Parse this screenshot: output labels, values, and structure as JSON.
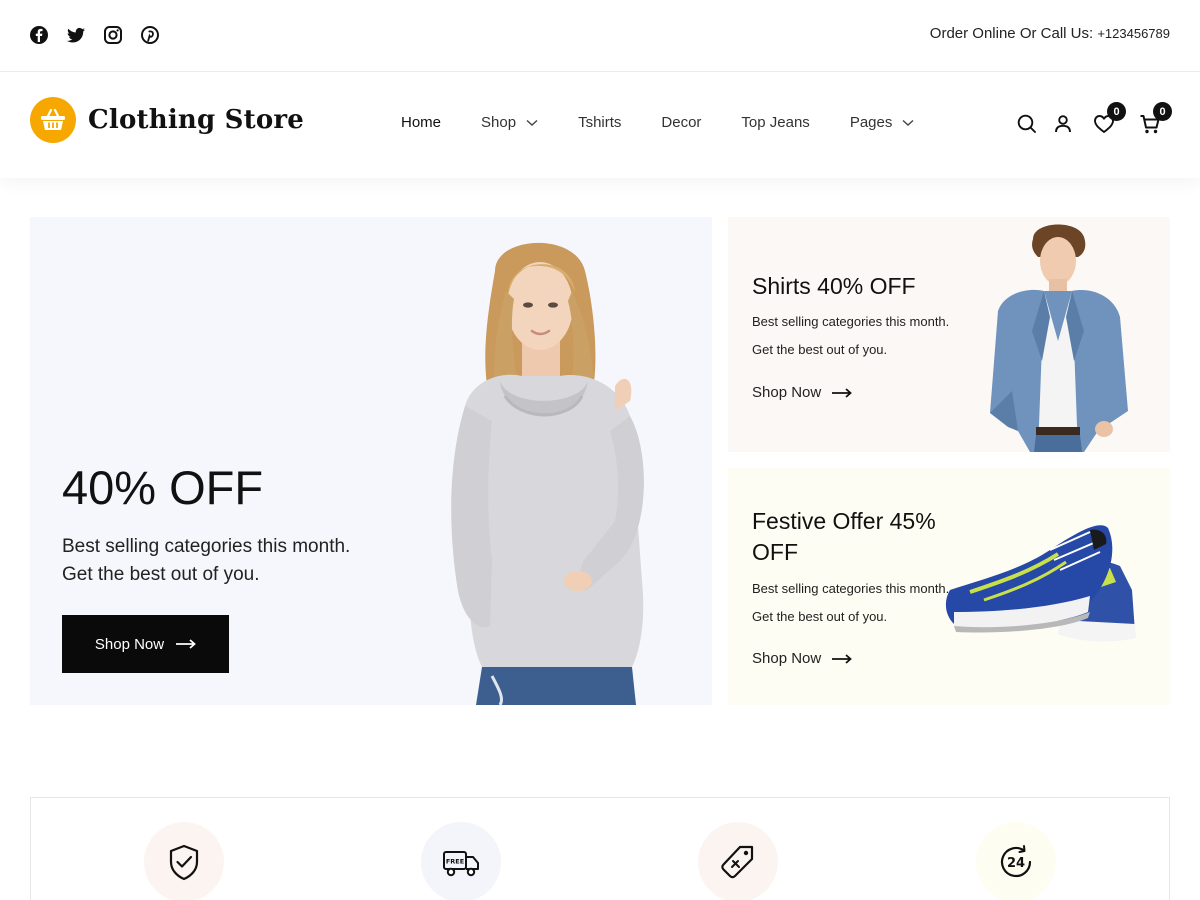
{
  "topbar": {
    "social_icons": [
      "facebook-icon",
      "twitter-icon",
      "instagram-icon",
      "pinterest-icon"
    ],
    "contact_label": "Order Online Or Call Us:",
    "phone": "+123456789"
  },
  "header": {
    "logo_text": "Clothing Store",
    "logo_icon": "basket-icon",
    "nav": [
      {
        "label": "Home",
        "active": true
      },
      {
        "label": "Shop",
        "dropdown": true
      },
      {
        "label": "Tshirts"
      },
      {
        "label": "Decor"
      },
      {
        "label": "Top Jeans"
      },
      {
        "label": "Pages",
        "dropdown": true
      }
    ],
    "wishlist_count": "0",
    "cart_count": "0",
    "icons": [
      "search-icon",
      "user-icon",
      "heart-icon",
      "cart-icon"
    ]
  },
  "hero": {
    "title": "40% OFF",
    "subtitle": "Best selling categories this month. Get the best out of you.",
    "button_label": "Shop Now"
  },
  "promos": [
    {
      "title": "Shirts 40% OFF",
      "subtitle": "Best selling categories this month. Get the best out of you.",
      "link": "Shop Now"
    },
    {
      "title": "Festive Offer 45% OFF",
      "subtitle": "Best selling categories this month. Get the best out of you.",
      "link": "Shop Now"
    }
  ],
  "features": {
    "icons": [
      "shield-check-icon",
      "free-delivery-truck-icon",
      "price-tag-icon",
      "support-24-icon"
    ]
  },
  "colors": {
    "brand": "#f7a800",
    "dark": "#0a0a0a",
    "hero_bg": "#f6f7fc",
    "promo1_bg": "#fcf8f6",
    "promo2_bg": "#fdfdf3"
  }
}
